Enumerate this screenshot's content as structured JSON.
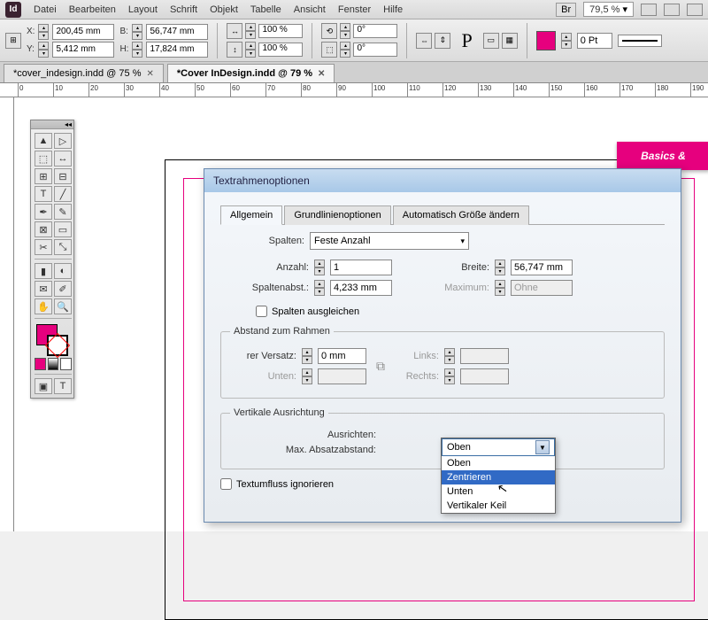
{
  "menubar": {
    "logo": "Id",
    "items": [
      "Datei",
      "Bearbeiten",
      "Layout",
      "Schrift",
      "Objekt",
      "Tabelle",
      "Ansicht",
      "Fenster",
      "Hilfe"
    ],
    "br_label": "Br",
    "zoom": "79,5 %"
  },
  "controlbar": {
    "x_label": "X:",
    "x_value": "200,45 mm",
    "y_label": "Y:",
    "y_value": "5,412 mm",
    "w_label": "B:",
    "w_value": "56,747 mm",
    "h_label": "H:",
    "h_value": "17,824 mm",
    "scale_x": "100 %",
    "scale_y": "100 %",
    "rotate": "0°",
    "shear": "0°",
    "char_glyph": "P",
    "stroke_weight": "0 Pt"
  },
  "tabs": [
    {
      "label": "*cover_indesign.indd @ 75 %",
      "active": false
    },
    {
      "label": "*Cover InDesign.indd @ 79 %",
      "active": true
    }
  ],
  "ruler_marks": [
    0,
    10,
    20,
    30,
    40,
    50,
    60,
    70,
    80,
    90,
    100,
    110,
    120,
    130,
    140,
    150,
    160,
    170,
    180,
    190
  ],
  "pink_box_text": "Basics &",
  "dialog": {
    "title": "Textrahmenoptionen",
    "tabs": [
      "Allgemein",
      "Grundlinienoptionen",
      "Automatisch Größe ändern"
    ],
    "active_tab": 0,
    "spalten": {
      "label": "Spalten:",
      "select_value": "Feste Anzahl",
      "anzahl_label": "Anzahl:",
      "anzahl": "1",
      "abstand_label": "Spaltenabst.:",
      "abstand": "4,233 mm",
      "breite_label": "Breite:",
      "breite": "56,747 mm",
      "max_label": "Maximum:",
      "max": "Ohne",
      "ausgleichen": "Spalten ausgleichen"
    },
    "abstand": {
      "legend": "Abstand zum Rahmen",
      "oben_label": "rer Versatz:",
      "oben": "0 mm",
      "unten_label": "Unten:",
      "links_label": "Links:",
      "rechts_label": "Rechts:"
    },
    "valign": {
      "legend": "Vertikale Ausrichtung",
      "ausrichten_label": "Ausrichten:",
      "ausrichten_value": "Oben",
      "max_abs_label": "Max. Absatzabstand:",
      "options": [
        "Oben",
        "Zentrieren",
        "Unten",
        "Vertikaler Keil"
      ],
      "highlight_index": 1
    },
    "textumfluss": "Textumfluss ignorieren"
  }
}
